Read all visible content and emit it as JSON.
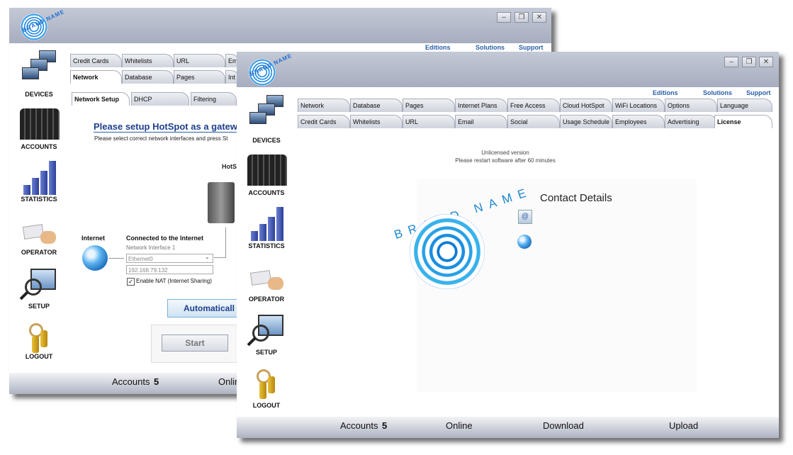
{
  "back_window": {
    "logo_text": "BRAND NAME",
    "top_links": [
      "Editions",
      "Solutions",
      "Support"
    ],
    "sidebar": [
      "DEVICES",
      "ACCOUNTS",
      "STATISTICS",
      "OPERATOR",
      "SETUP",
      "LOGOUT"
    ],
    "tabs_row1": [
      "Credit Cards",
      "Whitelists",
      "URL",
      "Em"
    ],
    "tabs_row2": [
      "Network",
      "Database",
      "Pages",
      "Int"
    ],
    "subtabs": [
      "Network Setup",
      "DHCP",
      "Filtering"
    ],
    "setup_title": "Please setup HotSpot as a gatew",
    "setup_desc": "Please select correct network interfaces and press St",
    "hotspot_label": "HotS",
    "internet_label": "Internet",
    "connected_label": "Connected to the Internet",
    "interface_label": "Network Interface 1",
    "interface_value": "Ethernet0",
    "ip_value": "192.168.79.132",
    "nat_label": "Enable NAT (Internet Sharing)",
    "auto_button": "Automaticall",
    "start_button": "Start",
    "footer": {
      "accounts_label": "Accounts",
      "accounts_value": "5",
      "online_label": "Onlin"
    }
  },
  "front_window": {
    "logo_text": "BRAND NAME",
    "top_links": [
      "Editions",
      "Solutions",
      "Support"
    ],
    "sidebar": [
      "DEVICES",
      "ACCOUNTS",
      "STATISTICS",
      "OPERATOR",
      "SETUP",
      "LOGOUT"
    ],
    "tabs_row1": [
      "Network",
      "Database",
      "Pages",
      "Internet Plans",
      "Free Access",
      "Cloud HotSpot",
      "WiFi Locations",
      "Options",
      "Language"
    ],
    "tabs_row2": [
      "Credit Cards",
      "Whitelists",
      "URL",
      "Email",
      "Social",
      "Usage Schedule",
      "Employees",
      "Advertising",
      "License"
    ],
    "license_line1": "Unlicensed version",
    "license_line2": "Please restart software after 60 minutes",
    "brand_big": "BRAND NAME",
    "contact_title": "Contact Details",
    "footer": {
      "accounts_label": "Accounts",
      "accounts_value": "5",
      "online_label": "Online",
      "download_label": "Download",
      "upload_label": "Upload"
    }
  }
}
